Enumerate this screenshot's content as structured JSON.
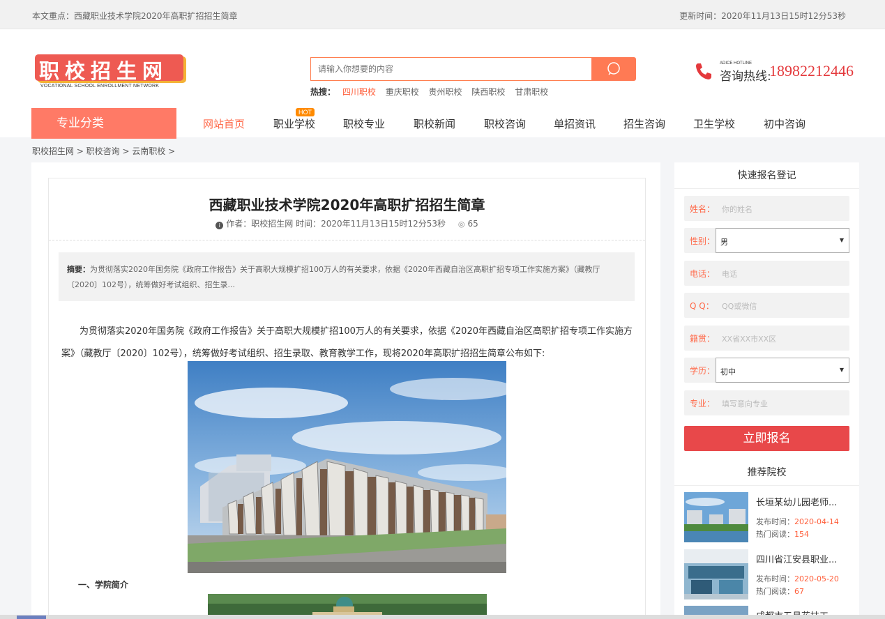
{
  "topbar": {
    "focus": "本文重点：西藏职业技术学院2020年高职扩招招生简章",
    "updated": "更新时间：2020年11月13日15时12分53秒"
  },
  "logo": {
    "text": "职校招生网",
    "subtitle": "VOCATIONAL SCHOOL ENROLLMENT NETWORK"
  },
  "search": {
    "placeholder": "请输入你想要的内容",
    "hot_label": "热搜：",
    "hot_items": [
      "四川职校",
      "重庆职校",
      "贵州职校",
      "陕西职校",
      "甘肃职校"
    ]
  },
  "hotline": {
    "en": "ADICE HOTLINE",
    "cn": "咨询热线:",
    "number": "18982212446"
  },
  "nav": {
    "category": "专业分类",
    "hot_badge": "HOT",
    "items": [
      "网站首页",
      "职业学校",
      "职校专业",
      "职校新闻",
      "职校咨询",
      "单招资讯",
      "招生咨询",
      "卫生学校",
      "初中咨询"
    ]
  },
  "breadcrumb": "职校招生网 > 职校咨询 > 云南职校 >",
  "article": {
    "title": "西藏职业技术学院2020年高职扩招招生简章",
    "author_label": "作者：",
    "author": "职校招生网",
    "time": "时间：2020年11月13日15时12分53秒",
    "views": "65",
    "summary_label": "摘要：",
    "summary": "为贯彻落实2020年国务院《政府工作报告》关于高职大规模扩招100万人的有关要求，依据《2020年西藏自治区高职扩招专项工作实施方案》（藏教厅〔2020〕102号），统筹做好考试组织、招生录...",
    "paragraph": "为贯彻落实2020年国务院《政府工作报告》关于高职大规模扩招100万人的有关要求，依据《2020年西藏自治区高职扩招专项工作实施方案》（藏教厅〔2020〕102号），统筹做好考试组织、招生录取、教育教学工作，现将2020年高职扩招招生简章公布如下:",
    "section1": "一、学院简介"
  },
  "signup": {
    "title": "快速报名登记",
    "fields": [
      {
        "label": "姓名：",
        "placeholder": "你的姓名"
      },
      {
        "label": "性别：",
        "value": "男"
      },
      {
        "label": "电话：",
        "placeholder": "电话"
      },
      {
        "label": "Q Q：",
        "placeholder": "QQ或微信"
      },
      {
        "label": "籍贯：",
        "placeholder": "XX省XX市XX区"
      },
      {
        "label": "学历：",
        "value": "初中"
      },
      {
        "label": "专业：",
        "placeholder": "填写意向专业"
      }
    ],
    "submit": "立即报名"
  },
  "recommend": {
    "title": "推荐院校",
    "date_label": "发布时间：",
    "read_label": "热门阅读：",
    "items": [
      {
        "name": "长垣某幼儿园老师...",
        "date": "2020-04-14",
        "reads": "154"
      },
      {
        "name": "四川省江安县职业...",
        "date": "2020-05-20",
        "reads": "67"
      },
      {
        "name": "成都市五月花技工..."
      }
    ]
  },
  "colors": {
    "accent": "#ff7a54",
    "category": "#ff7a66",
    "submit": "#e8484a",
    "hotline": "#e4393c"
  }
}
